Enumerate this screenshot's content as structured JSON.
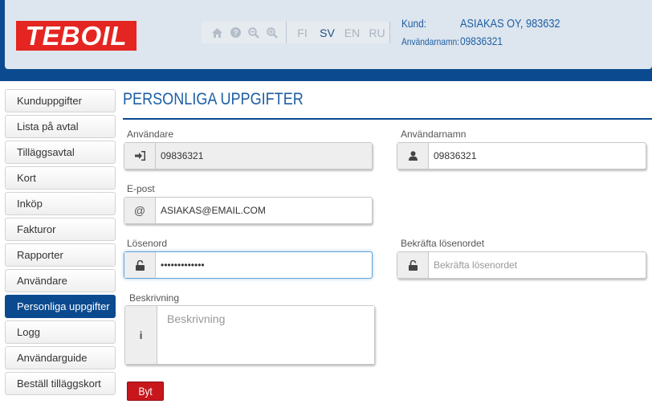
{
  "brand": {
    "logo_text": "TEBOIL",
    "logo_color": "#e42521"
  },
  "toolbar": {
    "icons": [
      "home-icon",
      "help-icon",
      "zoom-out-icon",
      "zoom-in-icon"
    ],
    "languages": [
      "FI",
      "SV",
      "EN",
      "RU"
    ],
    "active_language": "SV"
  },
  "customer": {
    "customer_label": "Kund:",
    "customer_value": "ASIAKAS OY, 983632",
    "username_label": "Användarnamn:",
    "username_value": "09836321"
  },
  "sidebar": {
    "items": [
      {
        "label": "Kunduppgifter"
      },
      {
        "label": "Lista på avtal"
      },
      {
        "label": "Tilläggsavtal"
      },
      {
        "label": "Kort"
      },
      {
        "label": "Inköp"
      },
      {
        "label": "Fakturor"
      },
      {
        "label": "Rapporter"
      },
      {
        "label": "Användare"
      },
      {
        "label": "Personliga uppgifter",
        "active": true
      },
      {
        "label": "Logg"
      },
      {
        "label": "Användarguide"
      },
      {
        "label": "Beställ tilläggskort"
      }
    ]
  },
  "page": {
    "title": "PERSONLIGA UPPGIFTER"
  },
  "form": {
    "user_label": "Användare",
    "user_value": "09836321",
    "username_label": "Användarnamn",
    "username_value": "09836321",
    "email_label": "E-post",
    "email_addon": "@",
    "email_value": "ASIAKAS@EMAIL.COM",
    "password_label": "Lösenord",
    "password_value": "•••••••••••••",
    "confirm_label": "Bekräfta lösenordet",
    "confirm_placeholder": "Bekräfta lösenordet",
    "description_label": "Beskrivning",
    "description_addon": "i",
    "description_placeholder": "Beskrivning",
    "submit_label": "Byt"
  },
  "colors": {
    "accent": "#0b4a8f",
    "header_bg": "#dde5ee",
    "button": "#c8161d",
    "title": "#1d5fa3"
  }
}
